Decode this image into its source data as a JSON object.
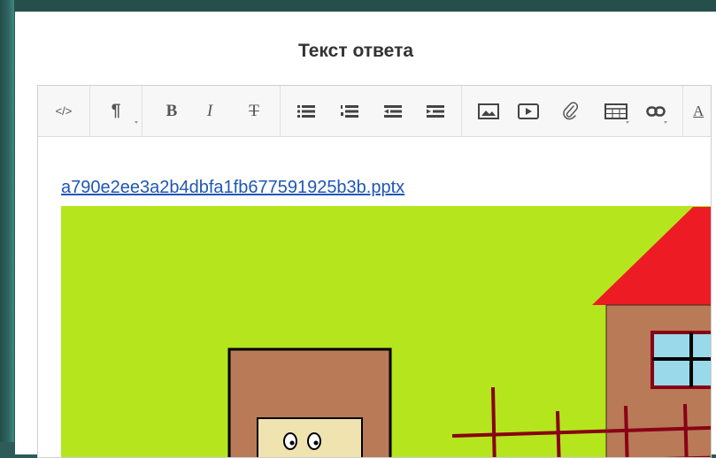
{
  "panel": {
    "title": "Текст ответа"
  },
  "toolbar": {
    "buttons": [
      {
        "name": "html-source-button",
        "glyph": "</>"
      },
      {
        "name": "paragraph-format-button",
        "glyph": "¶"
      },
      {
        "name": "bold-button",
        "glyph": "B"
      },
      {
        "name": "italic-button",
        "glyph": "I"
      },
      {
        "name": "strikethrough-button",
        "glyph": "T"
      },
      {
        "name": "bullet-list-button",
        "icon": "bullet-list-icon"
      },
      {
        "name": "numbered-list-button",
        "icon": "numbered-list-icon"
      },
      {
        "name": "outdent-button",
        "icon": "outdent-icon"
      },
      {
        "name": "indent-button",
        "icon": "indent-icon"
      },
      {
        "name": "insert-image-button",
        "icon": "image-icon"
      },
      {
        "name": "insert-video-button",
        "icon": "video-icon"
      },
      {
        "name": "attach-file-button",
        "icon": "paperclip-icon"
      },
      {
        "name": "insert-table-button",
        "icon": "table-icon"
      },
      {
        "name": "insert-link-button",
        "icon": "link-icon"
      },
      {
        "name": "text-color-button",
        "glyph": "A"
      }
    ]
  },
  "content": {
    "attachment_link": "a790e2ee3a2b4dbfa1fb677591925b3b.pptx",
    "image": {
      "background_color": "#b5e61d",
      "roof_color": "#ed1c24",
      "wall_color": "#b97a57",
      "window_color": "#99d9ea",
      "fence_color": "#880015"
    }
  }
}
